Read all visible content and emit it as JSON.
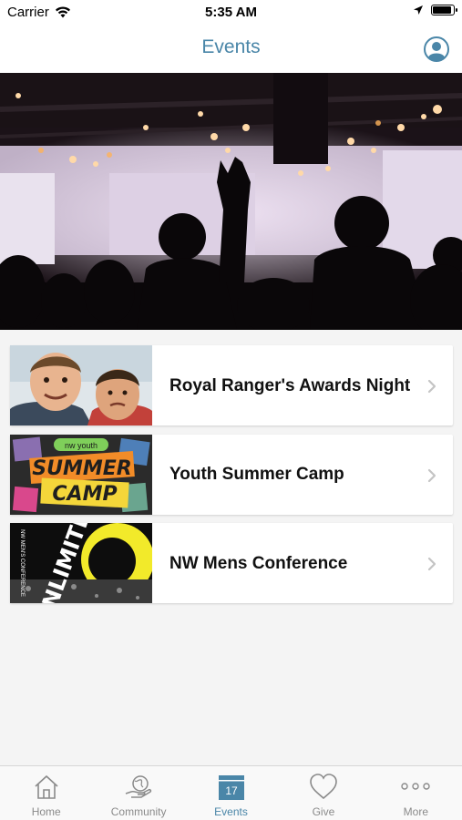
{
  "status_bar": {
    "carrier": "Carrier",
    "time": "5:35 AM",
    "battery_level": 0.9
  },
  "nav": {
    "title": "Events",
    "profile_icon": "person-circle-icon",
    "accent_color": "#4a86a8"
  },
  "hero": {
    "image": "concert-crowd-photo"
  },
  "events": [
    {
      "title": "Royal Ranger's Awards Night",
      "thumbnail": "two-boys-photo"
    },
    {
      "title": "Youth Summer Camp",
      "thumbnail": "summer-camp-graphic",
      "thumbnail_text": [
        "SUMMER",
        "CAMP"
      ],
      "thumbnail_badge": "nw youth"
    },
    {
      "title": "NW Mens Conference",
      "thumbnail": "unlimited-conference-graphic",
      "thumbnail_text": "UNLIMITED",
      "thumbnail_side_text": "NW MEN'S CONFERENCE"
    }
  ],
  "tabs": [
    {
      "label": "Home",
      "icon": "home-icon",
      "active": false
    },
    {
      "label": "Community",
      "icon": "community-globe-icon",
      "active": false
    },
    {
      "label": "Events",
      "icon": "calendar-icon",
      "active": true,
      "calendar_day": "17"
    },
    {
      "label": "Give",
      "icon": "heart-icon",
      "active": false
    },
    {
      "label": "More",
      "icon": "more-dots-icon",
      "active": false
    }
  ]
}
